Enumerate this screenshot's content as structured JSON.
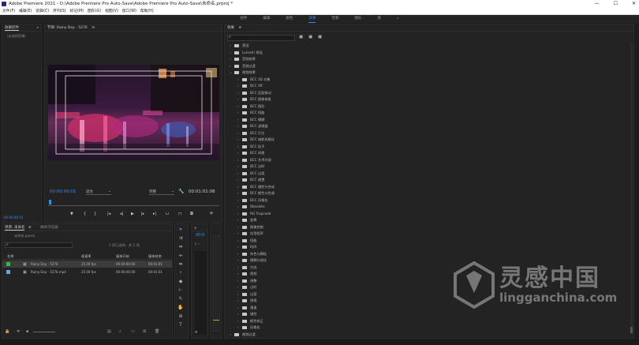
{
  "window": {
    "title": "Adobe Premiere  2021 - D:\\Adobe Premiere Pro Auto-Save\\Adobe Premiere Pro Auto-Save\\未命名.prproj *",
    "minimize": "—",
    "maximize": "☐",
    "close": "✕"
  },
  "menu": [
    "文件(F)",
    "编辑(E)",
    "剪辑(C)",
    "序列(S)",
    "标记(M)",
    "图形(G)",
    "视图(V)",
    "窗口(W)",
    "帮助(H)"
  ],
  "workspaces": {
    "items": [
      "组件",
      "编辑",
      "颜色",
      "效果",
      "音频",
      "图形",
      "库"
    ],
    "active": "效果",
    "more": "»"
  },
  "left_panel": {
    "tab": "效果控件",
    "more": "»",
    "placeholder": "（未选择剪辑）"
  },
  "program": {
    "tab": "节目: Rainy Day - 5276",
    "menu": "≡",
    "timecode": "00:00:00:01",
    "fit": "适合",
    "quality": "完整",
    "duration": "00:01:01:08"
  },
  "project": {
    "tab": "项目: 未命名",
    "menu": "≡",
    "tab2": "媒体浏览器",
    "file": "未命名.prproj",
    "selection": "1 项已选择，共 2 项",
    "columns": {
      "name": "名称",
      "fps": "帧速率",
      "start": "媒体开始",
      "end": "媒体结束"
    },
    "rows": [
      {
        "name": "Rainy Day - 5276",
        "fps": "25.00 fps",
        "start": "00:00:00:00",
        "end": "00:01:01",
        "color": "#3bb34a"
      },
      {
        "name": "Rainy Day - 5276.mp4",
        "fps": "25.00 fps",
        "start": "00:00:00:00",
        "end": "00:01:01",
        "color": "#6fa0d8"
      }
    ]
  },
  "timeline": {
    "timecode": "00:0",
    "close": "×"
  },
  "effects": {
    "tab": "效果",
    "menu": "≡",
    "search_placeholder": "",
    "search_icon": "magnifier-icon",
    "items": [
      {
        "label": "预设",
        "level": 0,
        "open": false
      },
      {
        "label": "Lumetri 预设",
        "level": 0,
        "open": false
      },
      {
        "label": "音频效果",
        "level": 0,
        "open": false
      },
      {
        "label": "音频过渡",
        "level": 0,
        "open": false
      },
      {
        "label": "视频效果",
        "level": 0,
        "open": true
      },
      {
        "label": "BCC 3D 对象",
        "level": 1,
        "open": false
      },
      {
        "label": "BCC VR",
        "level": 1,
        "open": false
      },
      {
        "label": "BCC 匹配移动",
        "level": 1,
        "open": false
      },
      {
        "label": "BCC 图像修复",
        "level": 1,
        "open": false
      },
      {
        "label": "BCC 图形",
        "level": 1,
        "open": false
      },
      {
        "label": "BCC 扭曲",
        "level": 1,
        "open": false
      },
      {
        "label": "BCC 模糊",
        "level": 1,
        "open": false
      },
      {
        "label": "BCC 滤镜器",
        "level": 1,
        "open": false
      },
      {
        "label": "BCC 灯光",
        "level": 1,
        "open": false
      },
      {
        "label": "BCC 电影风格化",
        "level": 1,
        "open": false
      },
      {
        "label": "BCC 粒子",
        "level": 1,
        "open": false
      },
      {
        "label": "BCC 纹理",
        "level": 1,
        "open": false
      },
      {
        "label": "BCC 艺术外观",
        "level": 1,
        "open": false
      },
      {
        "label": "BCC 过时",
        "level": 1,
        "open": false
      },
      {
        "label": "BCC 过渡",
        "level": 1,
        "open": false
      },
      {
        "label": "BCC 遮罩",
        "level": 1,
        "open": false
      },
      {
        "label": "BCC 键控与合成",
        "level": 1,
        "open": false
      },
      {
        "label": "BCC 颜色与色调",
        "level": 1,
        "open": false
      },
      {
        "label": "BCC 风格化",
        "level": 1,
        "open": false
      },
      {
        "label": "Obsolete",
        "level": 1,
        "open": false
      },
      {
        "label": "RG Trapcode",
        "level": 1,
        "open": false
      },
      {
        "label": "变换",
        "level": 1,
        "open": false
      },
      {
        "label": "图像控制",
        "level": 1,
        "open": false
      },
      {
        "label": "实用程序",
        "level": 1,
        "open": false
      },
      {
        "label": "扭曲",
        "level": 1,
        "open": false
      },
      {
        "label": "时间",
        "level": 1,
        "open": false
      },
      {
        "label": "杂色与颗粒",
        "level": 1,
        "open": false
      },
      {
        "label": "模糊与锐化",
        "level": 1,
        "open": false
      },
      {
        "label": "生成",
        "level": 1,
        "open": false
      },
      {
        "label": "视频",
        "level": 1,
        "open": false
      },
      {
        "label": "调整",
        "level": 1,
        "open": false
      },
      {
        "label": "过时",
        "level": 1,
        "open": false
      },
      {
        "label": "过渡",
        "level": 1,
        "open": false
      },
      {
        "label": "透视",
        "level": 1,
        "open": false
      },
      {
        "label": "通道",
        "level": 1,
        "open": false
      },
      {
        "label": "键控",
        "level": 1,
        "open": false
      },
      {
        "label": "颜色校正",
        "level": 1,
        "open": false
      },
      {
        "label": "风格化",
        "level": 1,
        "open": false
      },
      {
        "label": "视频过渡",
        "level": 0,
        "open": false
      }
    ]
  },
  "watermark": {
    "cn": "灵感中国",
    "url": "lingganchina.com"
  },
  "colors": {
    "accent": "#3d8ce8",
    "panel": "#232323",
    "background": "#1d1d1d"
  }
}
